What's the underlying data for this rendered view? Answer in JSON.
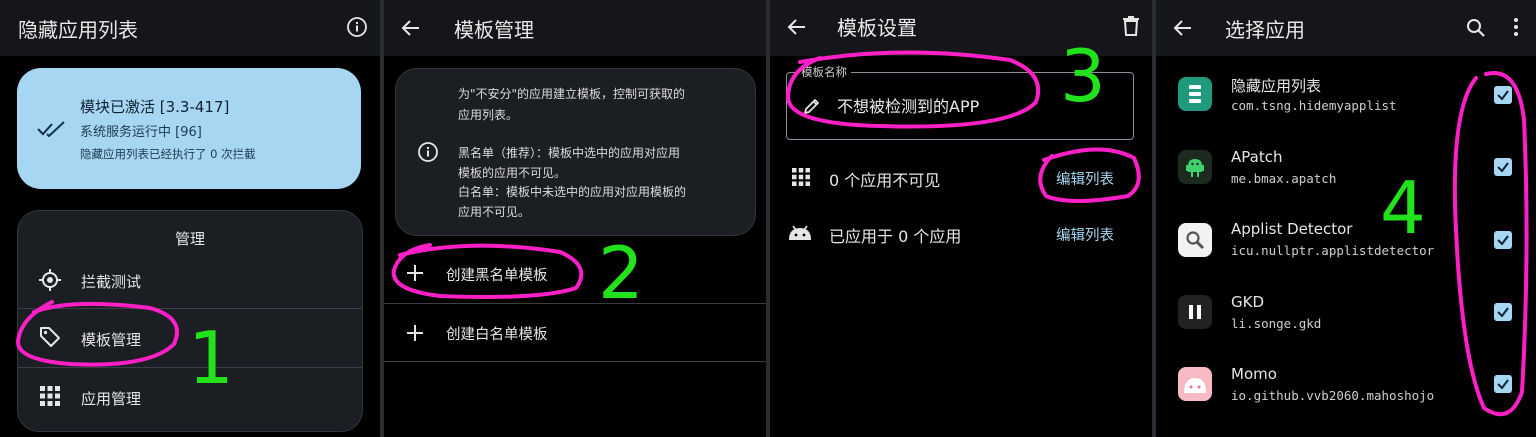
{
  "panel1": {
    "title": "隐藏应用列表",
    "status": {
      "title": "模块已激活 [3.3-417]",
      "service": "系统服务运行中 [96]",
      "count": "隐藏应用列表已经执行了 0 次拦截"
    },
    "manage": {
      "header": "管理",
      "items": [
        {
          "label": "拦截测试",
          "icon": "target-icon"
        },
        {
          "label": "模板管理",
          "icon": "tag-icon"
        },
        {
          "label": "应用管理",
          "icon": "grid-icon"
        }
      ]
    }
  },
  "panel2": {
    "title": "模板管理",
    "info": {
      "line1": "为\"不安分\"的应用建立模板，控制可获取的",
      "line2": "应用列表。",
      "line3": "黑名单（推荐）：模板中选中的应用对应用",
      "line4": "模板的应用不可见。",
      "line5": "白名单：模板中未选中的应用对应用模板的",
      "line6": "应用不可见。"
    },
    "actions": [
      "创建黑名单模板",
      "创建白名单模板"
    ]
  },
  "panel3": {
    "title": "模板设置",
    "field_label": "模板名称",
    "field_value": "不想被检测到的APP",
    "rows": [
      {
        "text": "0 个应用不可见",
        "action": "编辑列表"
      },
      {
        "text": "已应用于 0 个应用",
        "action": "编辑列表"
      }
    ]
  },
  "panel4": {
    "title": "选择应用",
    "apps": [
      {
        "name": "隐藏应用列表",
        "pkg": "com.tsng.hidemyapplist",
        "checked": true
      },
      {
        "name": "APatch",
        "pkg": "me.bmax.apatch",
        "checked": true
      },
      {
        "name": "Applist Detector",
        "pkg": "icu.nullptr.applistdetector",
        "checked": true
      },
      {
        "name": "GKD",
        "pkg": "li.songe.gkd",
        "checked": true
      },
      {
        "name": "Momo",
        "pkg": "io.github.vvb2060.mahoshojo",
        "checked": true
      }
    ]
  },
  "annotations": [
    "1",
    "2",
    "3",
    "4"
  ],
  "colors": {
    "highlight": "#ff1fc6",
    "annotation": "#22e21b",
    "accent": "#a7d6f2",
    "status_card": "#a7d6f2",
    "card_bg": "#1b1e22"
  }
}
